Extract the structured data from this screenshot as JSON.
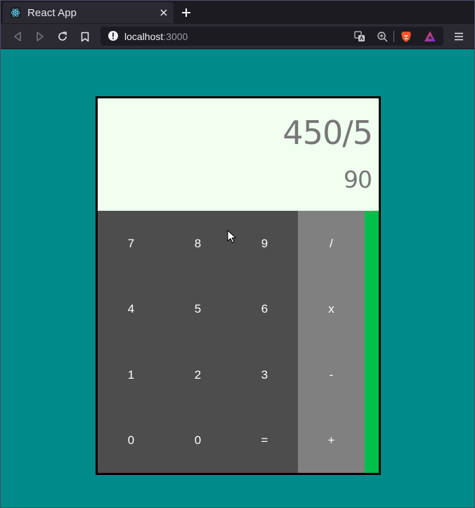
{
  "browser": {
    "tab_title": "React App",
    "url_host": "localhost",
    "url_port": ":3000"
  },
  "icons": {
    "favicon": "react-logo-icon",
    "close": "close-icon",
    "new_tab": "plus-icon",
    "back": "back-arrow-icon",
    "forward": "forward-arrow-icon",
    "reload": "reload-icon",
    "bookmark": "bookmark-icon",
    "site_info": "info-icon",
    "translate": "translate-icon",
    "zoom": "zoom-icon",
    "brave_shield": "brave-lion-icon",
    "brave_rewards": "brave-rewards-triangle-icon",
    "menu": "hamburger-menu-icon"
  },
  "colors": {
    "page_bg": "#008b8b",
    "display_bg": "#f0fff0",
    "keypad_bg": "#4d4d4d",
    "operator_bg": "#808080",
    "accent_green": "#00c04b"
  },
  "calculator": {
    "expression": "450/5",
    "result": "90",
    "keys": {
      "row1": [
        "7",
        "8",
        "9",
        "/"
      ],
      "row2": [
        "4",
        "5",
        "6",
        "x"
      ],
      "row3": [
        "1",
        "2",
        "3",
        "-"
      ],
      "row4": [
        "0",
        "0",
        "=",
        "+"
      ]
    }
  }
}
